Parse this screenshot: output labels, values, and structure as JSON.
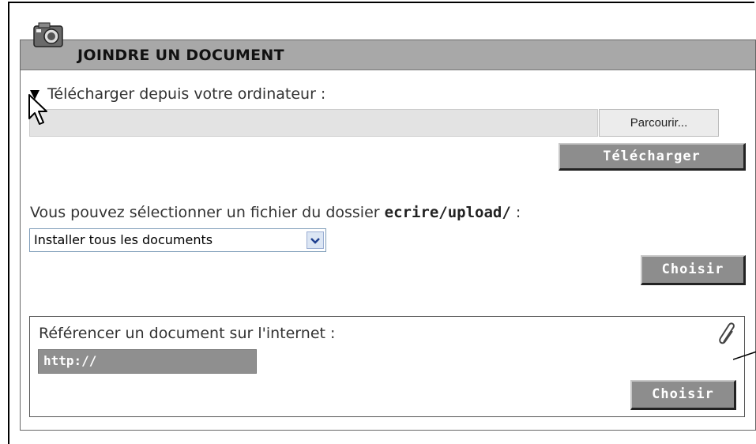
{
  "panel": {
    "title": "JOINDRE UN DOCUMENT"
  },
  "upload": {
    "label": "Télécharger depuis votre ordinateur :",
    "browse_label": "Parcourir...",
    "submit_label": "Télécharger"
  },
  "folder_select": {
    "label_prefix": "Vous pouvez sélectionner un fichier du dossier ",
    "folder": "ecrire/upload/",
    "label_suffix": " :",
    "selected": "Installer tous les documents",
    "choose_label": "Choisir"
  },
  "internet_ref": {
    "label": "Référencer un document sur l'internet :",
    "url_value": "http://",
    "choose_label": "Choisir"
  },
  "icons": {
    "header": "camera-icon",
    "disclosure": "triangle-down-icon",
    "cursor": "mouse-cursor-icon",
    "attachment": "paperclip-icon"
  },
  "colors": {
    "header_bg": "#a8a8a8",
    "button_bg": "#8d8d8d",
    "field_bg": "#e3e3e3"
  }
}
